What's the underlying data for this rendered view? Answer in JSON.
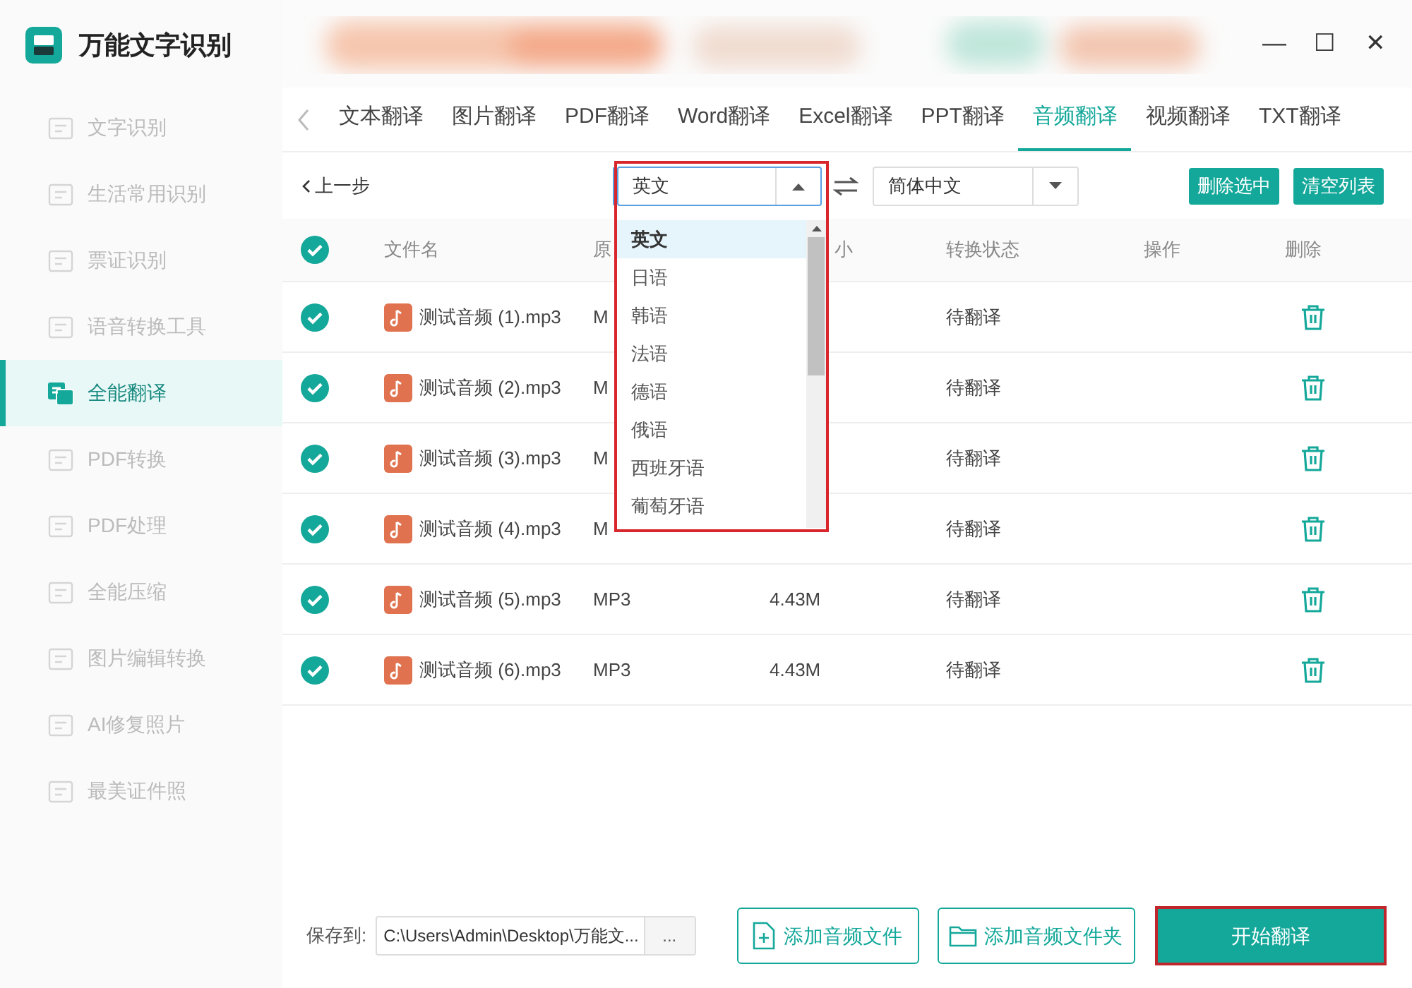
{
  "app": {
    "title": "万能文字识别"
  },
  "window_controls": [
    "—",
    "☐",
    "✕"
  ],
  "sidebar": {
    "items": [
      {
        "label": "文字识别",
        "selected": false
      },
      {
        "label": "生活常用识别",
        "selected": false
      },
      {
        "label": "票证识别",
        "selected": false
      },
      {
        "label": "语音转换工具",
        "selected": false
      },
      {
        "label": "全能翻译",
        "selected": true
      },
      {
        "label": "PDF转换",
        "selected": false
      },
      {
        "label": "PDF处理",
        "selected": false
      },
      {
        "label": "全能压缩",
        "selected": false
      },
      {
        "label": "图片编辑转换",
        "selected": false
      },
      {
        "label": "AI修复照片",
        "selected": false
      },
      {
        "label": "最美证件照",
        "selected": false
      }
    ]
  },
  "tabs": [
    {
      "label": "文本翻译",
      "selected": false
    },
    {
      "label": "图片翻译",
      "selected": false
    },
    {
      "label": "PDF翻译",
      "selected": false
    },
    {
      "label": "Word翻译",
      "selected": false
    },
    {
      "label": "Excel翻译",
      "selected": false
    },
    {
      "label": "PPT翻译",
      "selected": false
    },
    {
      "label": "音频翻译",
      "selected": true
    },
    {
      "label": "视频翻译",
      "selected": false
    },
    {
      "label": "TXT翻译",
      "selected": false
    }
  ],
  "toolbar": {
    "back": "上一步",
    "source_language": "英文",
    "target_language": "简体中文",
    "buttons": [
      "删除选中",
      "清空列表"
    ]
  },
  "dropdown": {
    "options": [
      {
        "label": "英文",
        "selected": true
      },
      {
        "label": "日语",
        "selected": false
      },
      {
        "label": "韩语",
        "selected": false
      },
      {
        "label": "法语",
        "selected": false
      },
      {
        "label": "德语",
        "selected": false
      },
      {
        "label": "俄语",
        "selected": false
      },
      {
        "label": "西班牙语",
        "selected": false
      },
      {
        "label": "葡萄牙语",
        "selected": false
      }
    ]
  },
  "table": {
    "all_checked": true,
    "columns": [
      "文件名",
      "原",
      "小",
      "转换状态",
      "操作",
      "删除"
    ],
    "rows": [
      {
        "checked": true,
        "name": "测试音频 (1).mp3",
        "format": "M",
        "status": "待翻译"
      },
      {
        "checked": true,
        "name": "测试音频 (2).mp3",
        "format": "M",
        "status": "待翻译"
      },
      {
        "checked": true,
        "name": "测试音频 (3).mp3",
        "format": "M",
        "status": "待翻译"
      },
      {
        "checked": true,
        "name": "测试音频 (4).mp3",
        "format": "M",
        "status": "待翻译"
      },
      {
        "checked": true,
        "name": "测试音频 (5).mp3",
        "format": "MP3",
        "size": "4.43M",
        "status": "待翻译"
      },
      {
        "checked": true,
        "name": "测试音频 (6).mp3",
        "format": "MP3",
        "size": "4.43M",
        "status": "待翻译"
      }
    ]
  },
  "footer": {
    "save_label": "保存到:",
    "save_path": "C:\\Users\\Admin\\Desktop\\万能文...",
    "browse": "...",
    "add_file": "添加音频文件",
    "add_folder": "添加音频文件夹",
    "start": "开始翻译"
  }
}
